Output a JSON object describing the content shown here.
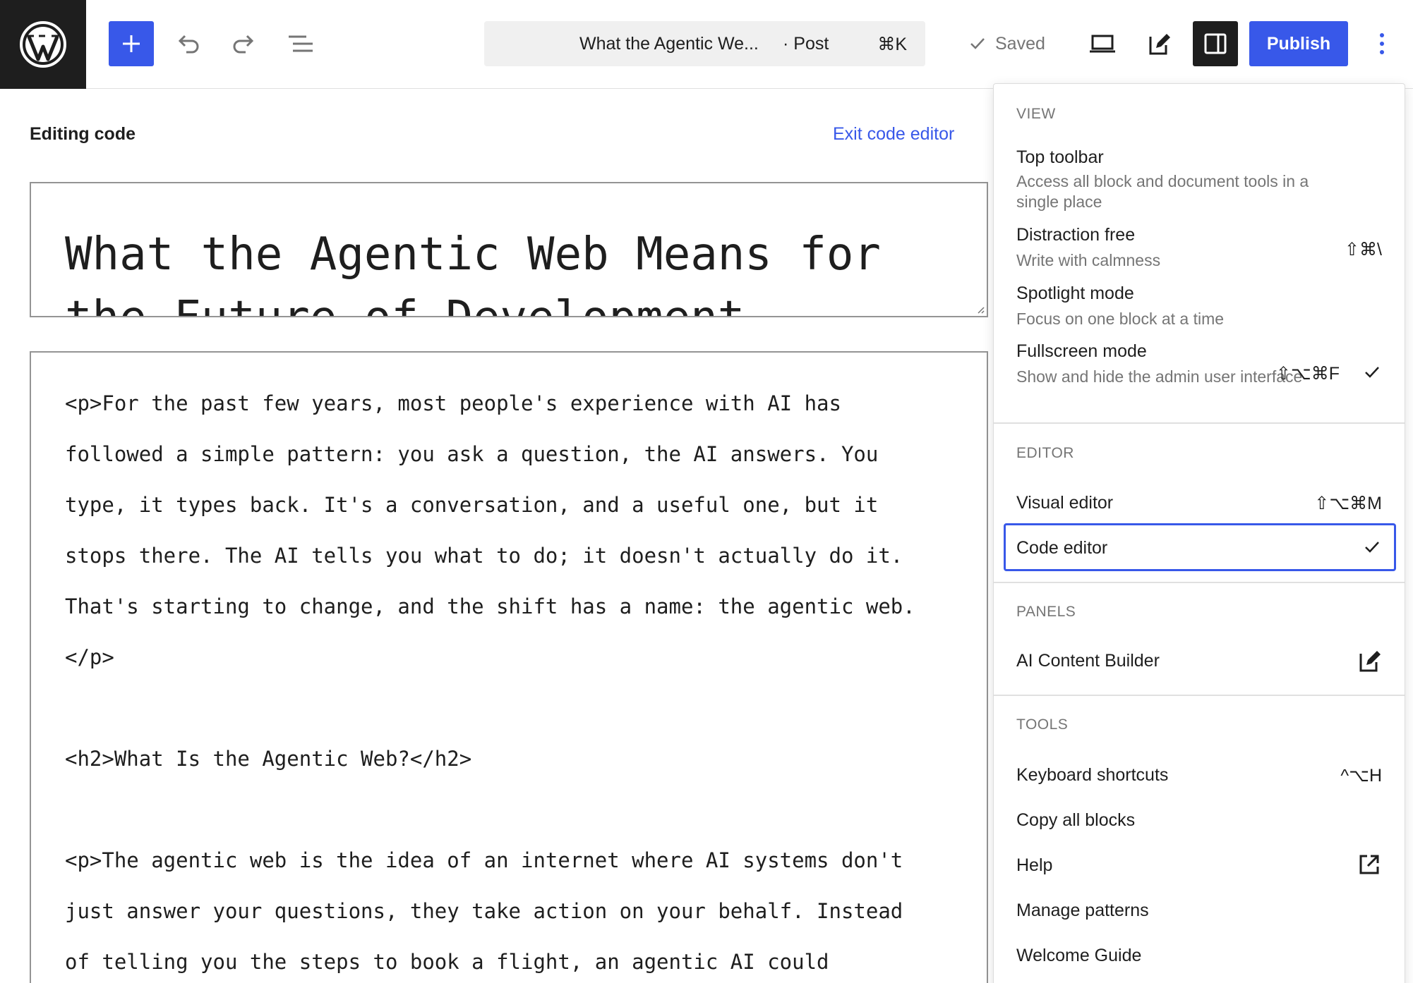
{
  "toolbar": {
    "document_title": "What the Agentic We...",
    "document_type": "· Post",
    "command_shortcut": "⌘K",
    "saved_label": "Saved",
    "publish_label": "Publish"
  },
  "editor": {
    "mode_label": "Editing code",
    "exit_label": "Exit code editor",
    "post_title": "What the Agentic Web Means for the Future of Development",
    "content_lines": [
      "<p>For the past few years, most people's experience with AI has",
      "followed a simple pattern: you ask a question, the AI answers. You",
      "type, it types back. It's a conversation, and a useful one, but it",
      "stops there. The AI tells you what to do; it doesn't actually do it.",
      "That's starting to change, and the shift has a name: the agentic web.",
      "</p>",
      "",
      "<h2>What Is the Agentic Web?</h2>",
      "",
      "<p>The agentic web is the idea of an internet where AI systems don't",
      "just answer your questions, they take action on your behalf. Instead",
      "of telling you the steps to book a flight, an agentic AI could"
    ]
  },
  "menu": {
    "view": {
      "label": "VIEW",
      "top_toolbar": {
        "label": "Top toolbar",
        "desc": "Access all block and document tools in a single place"
      },
      "distraction_free": {
        "label": "Distraction free",
        "desc": "Write with calmness",
        "shortcut": "⇧⌘\\"
      },
      "spotlight": {
        "label": "Spotlight mode",
        "desc": "Focus on one block at a time"
      },
      "fullscreen": {
        "label": "Fullscreen mode",
        "desc": "Show and hide the admin user interface",
        "shortcut": "⇧⌥⌘F"
      }
    },
    "editor": {
      "label": "EDITOR",
      "visual": {
        "label": "Visual editor",
        "shortcut": "⇧⌥⌘M"
      },
      "code": {
        "label": "Code editor"
      }
    },
    "panels": {
      "label": "PANELS",
      "ai_builder": {
        "label": "AI Content Builder"
      }
    },
    "tools": {
      "label": "TOOLS",
      "keyboard_shortcuts": {
        "label": "Keyboard shortcuts",
        "shortcut": "^⌥H"
      },
      "copy_all_blocks": {
        "label": "Copy all blocks"
      },
      "help": {
        "label": "Help"
      },
      "manage_patterns": {
        "label": "Manage patterns"
      },
      "welcome_guide": {
        "label": "Welcome Guide"
      }
    }
  },
  "colors": {
    "accent": "#3858e9",
    "dark": "#1e1e1e",
    "muted": "#757575"
  }
}
